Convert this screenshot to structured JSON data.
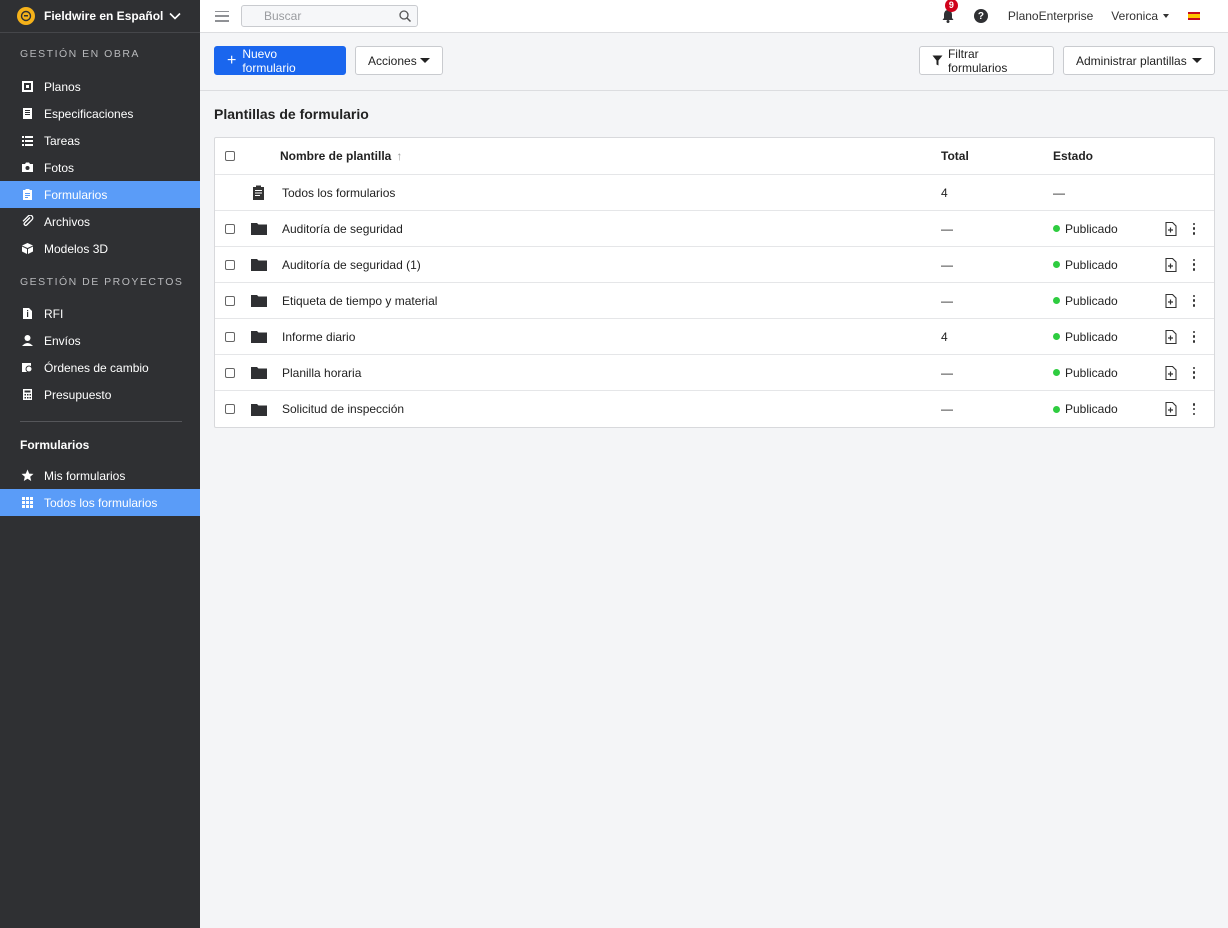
{
  "sidebar": {
    "project": "Fieldwire en Español",
    "section_obra": "GESTIÓN EN OBRA",
    "obra_items": [
      {
        "label": "Planos",
        "icon": "plans-icon"
      },
      {
        "label": "Especificaciones",
        "icon": "specs-icon"
      },
      {
        "label": "Tareas",
        "icon": "tasks-icon"
      },
      {
        "label": "Fotos",
        "icon": "camera-icon"
      },
      {
        "label": "Formularios",
        "icon": "forms-icon",
        "active": true
      },
      {
        "label": "Archivos",
        "icon": "paperclip-icon"
      },
      {
        "label": "Modelos 3D",
        "icon": "cube-icon"
      }
    ],
    "section_proyectos": "GESTIÓN DE PROYECTOS",
    "proyectos_items": [
      {
        "label": "RFI",
        "icon": "rfi-icon"
      },
      {
        "label": "Envíos",
        "icon": "submittal-icon"
      },
      {
        "label": "Órdenes de cambio",
        "icon": "change-order-icon"
      },
      {
        "label": "Presupuesto",
        "icon": "calculator-icon"
      }
    ],
    "forms_group_title": "Formularios",
    "forms_items": [
      {
        "label": "Mis formularios",
        "icon": "star-icon"
      },
      {
        "label": "Todos los formularios",
        "icon": "grid-icon",
        "active": true
      }
    ]
  },
  "topbar": {
    "search_placeholder": "Buscar",
    "notification_count": "9",
    "help": "?",
    "org": "PlanoEnterprise",
    "user": "Veronica"
  },
  "toolbar": {
    "new_form": "Nuevo formulario",
    "actions": "Acciones",
    "filter": "Filtrar formularios",
    "manage": "Administrar plantillas"
  },
  "content": {
    "title": "Plantillas de formulario",
    "columns": {
      "name": "Nombre de plantilla",
      "total": "Total",
      "status": "Estado"
    },
    "all_row": {
      "name": "Todos los formularios",
      "total": "4",
      "status": "—"
    },
    "rows": [
      {
        "name": "Auditoría de seguridad",
        "total": "—",
        "status": "Publicado"
      },
      {
        "name": "Auditoría de seguridad (1)",
        "total": "—",
        "status": "Publicado"
      },
      {
        "name": "Etiqueta de tiempo y material",
        "total": "—",
        "status": "Publicado"
      },
      {
        "name": "Informe diario",
        "total": "4",
        "status": "Publicado"
      },
      {
        "name": "Planilla horaria",
        "total": "—",
        "status": "Publicado"
      },
      {
        "name": "Solicitud de inspección",
        "total": "—",
        "status": "Publicado"
      }
    ]
  },
  "colors": {
    "sidebar_bg": "#2f3033",
    "active_bg": "#5a9cf8",
    "primary": "#1a66ee",
    "published_dot": "#2ecc40",
    "badge": "#d0021b"
  }
}
